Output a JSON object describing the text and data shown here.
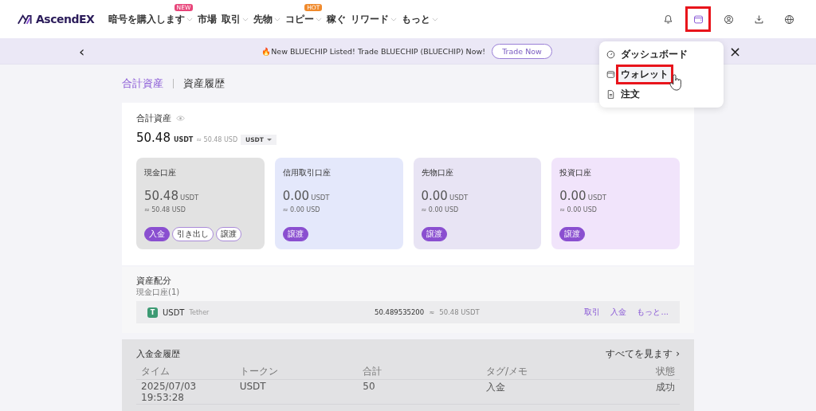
{
  "header": {
    "logo": "AscendEX",
    "nav": [
      {
        "label": "暗号を購入します",
        "dropdown": true,
        "badge": "NEW",
        "color": "#e8457a"
      },
      {
        "label": "市場",
        "dropdown": false
      },
      {
        "label": "取引",
        "dropdown": true
      },
      {
        "label": "先物",
        "dropdown": true
      },
      {
        "label": "コピー",
        "dropdown": true,
        "badge": "HOT",
        "color": "#f08a2c"
      },
      {
        "label": "稼ぐ",
        "dropdown": false
      },
      {
        "label": "リワード",
        "dropdown": true
      },
      {
        "label": "もっと",
        "dropdown": true
      }
    ],
    "icons": [
      {
        "kind": "bell",
        "selected": false
      },
      {
        "kind": "wallet",
        "selected": true
      },
      {
        "kind": "user",
        "selected": false
      },
      {
        "kind": "download",
        "selected": false
      },
      {
        "kind": "globe",
        "selected": false
      }
    ]
  },
  "banner": {
    "prev": "‹",
    "text": "🔥New BLUECHIP Listed! Trade BLUECHIP (BLUECHIP) Now!",
    "button": "Trade Now",
    "close": "×"
  },
  "wallet_menu": [
    {
      "kind": "dashboard",
      "label": "ダッシュボード",
      "selected": false
    },
    {
      "kind": "wallet",
      "label": "ウォレット",
      "selected": true
    },
    {
      "kind": "document",
      "label": "注文",
      "selected": false
    }
  ],
  "page_tabs": [
    {
      "label": "合計資産",
      "selected": true
    },
    {
      "label": "資産履歴",
      "selected": false
    }
  ],
  "summary": {
    "title": "合計資産",
    "amount": "50.48",
    "unit": "USDT",
    "approx": "≈ 50.48 USD",
    "currency": "USDT",
    "accounts": [
      {
        "name": "現金口座",
        "amount": "50.48",
        "unit": "USDT",
        "approx": "≈ 50.48 USD",
        "color": "#e2e2e2",
        "actions": [
          {
            "label": "入金",
            "primary": true
          },
          {
            "label": "引き出し",
            "primary": false
          },
          {
            "label": "譲渡",
            "primary": false
          }
        ]
      },
      {
        "name": "信用取引口座",
        "amount": "0.00",
        "unit": "USDT",
        "approx": "≈ 0.00 USD",
        "color": "#e4e8fb",
        "actions": [
          {
            "label": "譲渡",
            "primary": true
          }
        ]
      },
      {
        "name": "先物口座",
        "amount": "0.00",
        "unit": "USDT",
        "approx": "≈ 0.00 USD",
        "color": "#e8e4f4",
        "actions": [
          {
            "label": "譲渡",
            "primary": true
          }
        ]
      },
      {
        "name": "投資口座",
        "amount": "0.00",
        "unit": "USDT",
        "approx": "≈ 0.00 USD",
        "color": "#f1e4fb",
        "actions": [
          {
            "label": "譲渡",
            "primary": true
          }
        ]
      }
    ]
  },
  "allocation": {
    "title": "資産配分",
    "subtitle": "現金口座(1)",
    "rows": [
      {
        "token": "USDT",
        "token_name": "Tether",
        "token_icon": "T",
        "balance": "50.489535200",
        "approx": "≈",
        "value": "50.48 USDT",
        "links": [
          "取引",
          "入金",
          "もっと..."
        ]
      }
    ]
  },
  "deposits": {
    "title": "入金金履歴",
    "view_all": "すべてを見ます ›",
    "columns": [
      "タイム",
      "トークン",
      "合計",
      "タグ/メモ",
      "状態"
    ],
    "rows": [
      [
        "2025/07/03 19:53:28",
        "USDT",
        "50",
        "入金",
        "成功"
      ]
    ]
  }
}
